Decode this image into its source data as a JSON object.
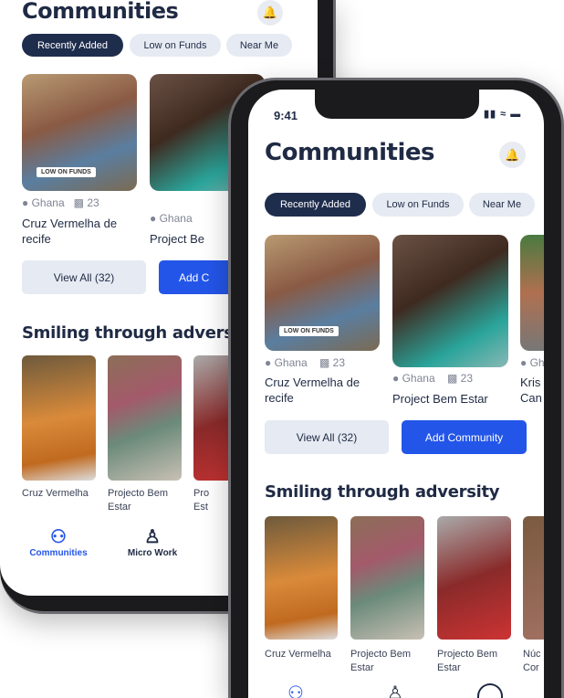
{
  "back_phone": {
    "title": "Communities",
    "filters": [
      "Recently Added",
      "Low on Funds",
      "Near Me"
    ],
    "cards": [
      {
        "badge": "LOW ON FUNDS",
        "location": "Ghana",
        "members": "23",
        "name": "Cruz Vermelha de recife"
      },
      {
        "location": "Ghana",
        "name": "Project Be"
      }
    ],
    "view_all": "View All (32)",
    "add": "Add C",
    "section": "Smiling through advers",
    "stories": [
      "Cruz Vermelha",
      "Projecto Bem Estar",
      "Pro Est"
    ],
    "nav": [
      "Communities",
      "Micro Work"
    ]
  },
  "front_phone": {
    "status_time": "9:41",
    "title": "Communities",
    "filters": [
      "Recently Added",
      "Low on Funds",
      "Near Me"
    ],
    "cards": [
      {
        "badge": "LOW ON FUNDS",
        "location": "Ghana",
        "members": "23",
        "name": "Cruz Vermelha de recife"
      },
      {
        "location": "Ghana",
        "members": "23",
        "name": "Project Bem Estar"
      },
      {
        "location": "Gh",
        "name": "Kris Can"
      }
    ],
    "view_all": "View All (32)",
    "add": "Add Community",
    "section": "Smiling through adversity",
    "stories": [
      "Cruz Vermelha",
      "Projecto Bem Estar",
      "Projecto Bem Estar",
      "Núc Cor"
    ]
  },
  "colors": {
    "primary": "#1f2d4d",
    "accent": "#2355e8",
    "chip": "#e6eaf2"
  }
}
